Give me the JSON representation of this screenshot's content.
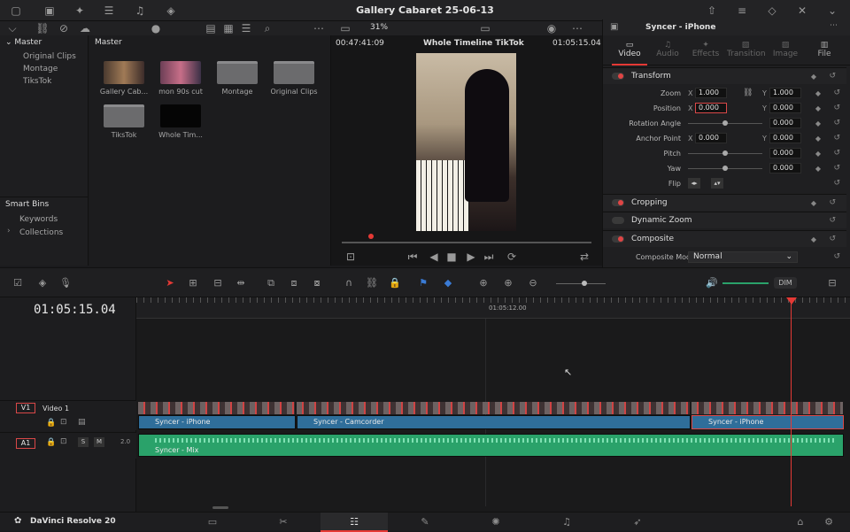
{
  "app": {
    "title": "Gallery Cabaret 25-06-13",
    "name": "DaVinci Resolve 20"
  },
  "bins": {
    "root": "Master",
    "items": [
      "Original Clips",
      "Montage",
      "TiksTok"
    ],
    "smart_title": "Smart Bins",
    "smart_items": [
      "Keywords",
      "Collections"
    ]
  },
  "mediapool": {
    "title": "Master",
    "clips": [
      "Gallery Cab...",
      "mon 90s cut",
      "Montage",
      "Original Clips",
      "TiksTok",
      "Whole Tim..."
    ]
  },
  "viewer": {
    "left_tc": "00:47:41:09",
    "timeline_name": "Whole Timeline TikTok",
    "right_tc": "01:05:15.04",
    "zoom": "31%"
  },
  "inspector": {
    "title": "Syncer - iPhone",
    "tabs": [
      "Video",
      "Audio",
      "Effects",
      "Transition",
      "Image",
      "File"
    ],
    "transform": "Transform",
    "rows": [
      {
        "label": "Zoom",
        "x": "1.000",
        "y": "1.000"
      },
      {
        "label": "Position",
        "x": "0.000",
        "y": "0.000"
      },
      {
        "label": "Rotation Angle",
        "v": "0.000"
      },
      {
        "label": "Anchor Point",
        "x": "0.000",
        "y": "0.000"
      },
      {
        "label": "Pitch",
        "v": "0.000"
      },
      {
        "label": "Yaw",
        "v": "0.000"
      },
      {
        "label": "Flip"
      }
    ],
    "ax_x": "X",
    "ax_y": "Y",
    "cropping": "Cropping",
    "dynamic_zoom": "Dynamic Zoom",
    "composite": "Composite",
    "composite_mode_label": "Composite Mode",
    "composite_mode": "Normal"
  },
  "timeline": {
    "timecode": "01:05:15.04",
    "ruler_label": "01:05:12.00",
    "dim": "DIM",
    "v1": {
      "id": "V1",
      "name": "Video 1"
    },
    "a1": {
      "id": "A1",
      "level": "2.0",
      "s": "S",
      "m": "M"
    },
    "clips": [
      "Syncer - iPhone",
      "Syncer - Camcorder",
      "Syncer - iPhone",
      "Syncer - Mix"
    ]
  }
}
